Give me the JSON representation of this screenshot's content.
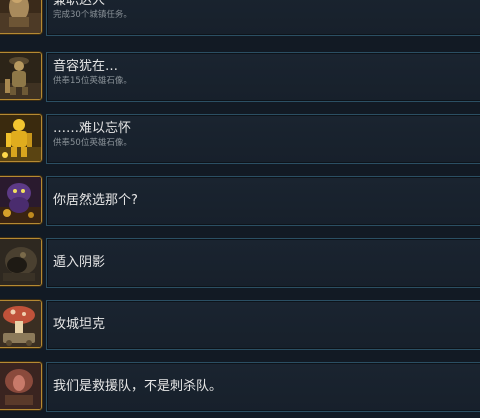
{
  "achievements": [
    {
      "icon": "worker-figure-icon",
      "title": "兼职达人",
      "subtitle": "完成30个城镇任务。"
    },
    {
      "icon": "hero-statue-icon",
      "title": "音容犹在…",
      "subtitle": "供奉15位英雄石像。"
    },
    {
      "icon": "golden-statue-icon",
      "title": "……难以忘怀",
      "subtitle": "供奉50位英雄石像。"
    },
    {
      "icon": "purple-imp-icon",
      "title": "你居然选那个?",
      "subtitle": ""
    },
    {
      "icon": "shadow-beast-icon",
      "title": "遁入阴影",
      "subtitle": ""
    },
    {
      "icon": "mushroom-tank-icon",
      "title": "攻城坦克",
      "subtitle": ""
    },
    {
      "icon": "rescue-squad-icon",
      "title": "我们是救援队，不是刺杀队。",
      "subtitle": ""
    }
  ],
  "colors": {
    "background": "#121a24",
    "card_border": "#2b4f63",
    "icon_frame": "#b58a33"
  }
}
